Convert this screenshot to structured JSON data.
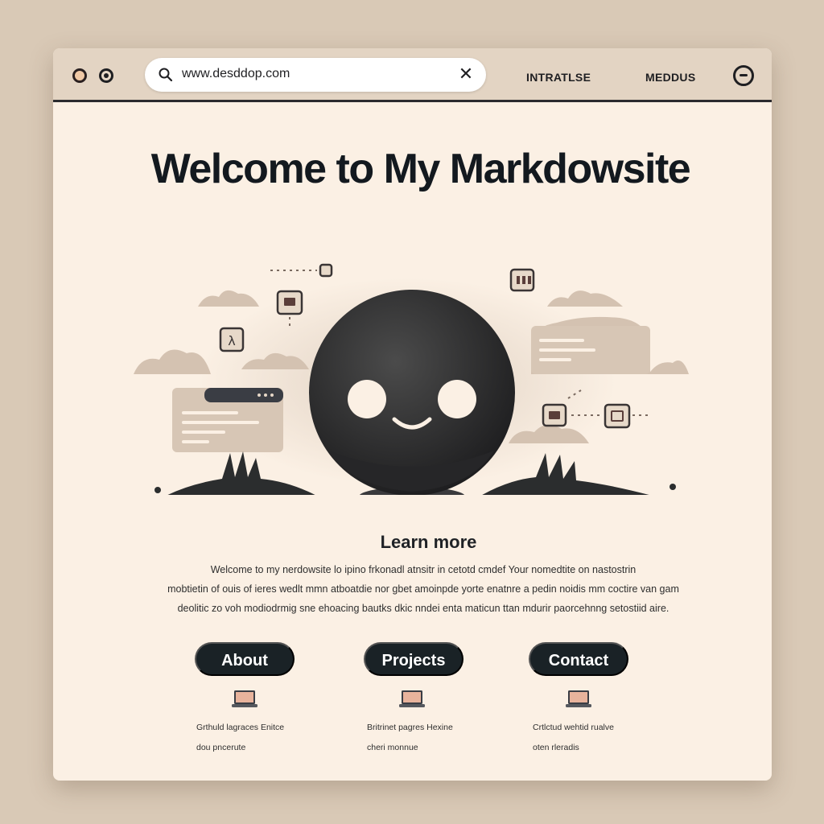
{
  "browser": {
    "url": "www.desddop.com",
    "nav_links": [
      "INTRATLSE",
      "MEDDUS"
    ]
  },
  "hero": {
    "title": "Welcome to My Markdowsite"
  },
  "section": {
    "title": "Learn more",
    "lines": [
      "Welcome to my nerdowsite lo ipino frkonadl atnsitr in cetotd cmdef Your nomedtite on nastostrin",
      "mobtietin of ouis of ieres wedlt mmn atboatdie nor gbet amoinpde yorte enatnre a pedin noidis mm coctire van gam",
      "deolitic zo voh modiodrmig sne ehoacing bautks dkic nndei enta maticun ttan mdurir paorcehnng setostiid aire."
    ]
  },
  "buttons": [
    {
      "label": "About",
      "caption": [
        "Grthuld lagraces Enitce",
        "dou pncerute"
      ]
    },
    {
      "label": "Projects",
      "caption": [
        "Britrinet pagres Hexine",
        "cheri monnue"
      ]
    },
    {
      "label": "Contact",
      "caption": [
        "Crtlctud wehtid rualve",
        "oten rleradis"
      ]
    }
  ],
  "colors": {
    "page_bg": "#d9c9b6",
    "window_bg": "#fbf0e4",
    "titlebar": "#e3d4c3",
    "dark": "#1a2226",
    "accent_sand": "#c9b7a6"
  },
  "icons": [
    "search-icon",
    "close-icon",
    "menu-icon",
    "laptop-icon",
    "robot-mascot"
  ]
}
